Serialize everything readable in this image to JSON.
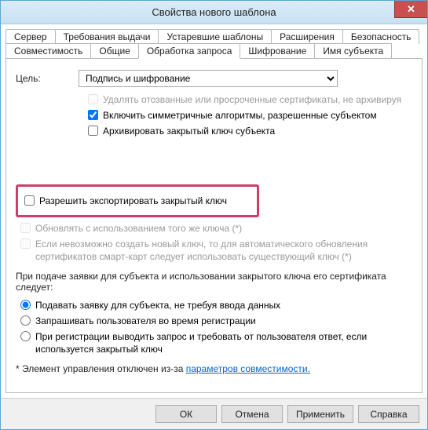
{
  "window": {
    "title": "Свойства нового шаблона"
  },
  "tabs": {
    "row1": [
      "Сервер",
      "Требования выдачи",
      "Устаревшие шаблоны",
      "Расширения",
      "Безопасность"
    ],
    "row2": [
      "Совместимость",
      "Общие",
      "Обработка запроса",
      "Шифрование",
      "Имя субъекта"
    ],
    "active": "Обработка запроса"
  },
  "purpose": {
    "label": "Цель:",
    "value": "Подпись и шифрование"
  },
  "checks": {
    "delete_revoked": {
      "label": "Удалять отозванные или просроченные сертификаты, не архивируя",
      "checked": false,
      "enabled": false
    },
    "include_sym": {
      "label": "Включить симметричные алгоритмы, разрешенные субъектом",
      "checked": true,
      "enabled": true
    },
    "archive_key": {
      "label": "Архивировать закрытый ключ субъекта",
      "checked": false,
      "enabled": true
    },
    "allow_export": {
      "label": "Разрешить экспортировать закрытый ключ",
      "checked": false,
      "enabled": true
    },
    "renew_same": {
      "label": "Обновлять с использованием того же ключа (*)",
      "checked": false,
      "enabled": false
    },
    "use_existing": {
      "label": "Если невозможно создать новый ключ, то для автоматического обновления сертификатов смарт-карт следует использовать существующий ключ (*)",
      "checked": false,
      "enabled": false
    }
  },
  "behavior": {
    "heading": "При подаче заявки для субъекта и использовании закрытого ключа его сертификата следует:",
    "opt_silent": "Подавать заявку для субъекта, не требуя ввода данных",
    "opt_prompt": "Запрашивать пользователя во время регистрации",
    "opt_prompt_key": "При регистрации выводить запрос и требовать от пользователя ответ, если используется закрытый ключ",
    "selected": "silent"
  },
  "footnote": {
    "prefix": "* Элемент управления отключен из-за ",
    "link": "параметров совместимости."
  },
  "buttons": {
    "ok": "ОК",
    "cancel": "Отмена",
    "apply": "Применить",
    "help": "Справка"
  }
}
